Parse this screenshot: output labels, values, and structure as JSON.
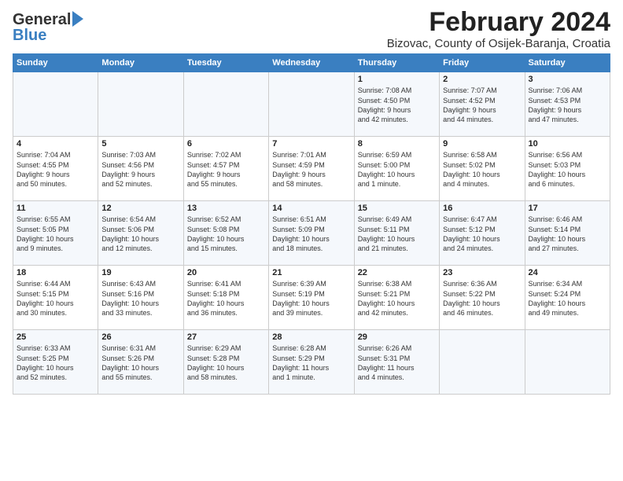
{
  "header": {
    "logo_general": "General",
    "logo_blue": "Blue",
    "main_title": "February 2024",
    "sub_title": "Bizovac, County of Osijek-Baranja, Croatia"
  },
  "calendar": {
    "days_of_week": [
      "Sunday",
      "Monday",
      "Tuesday",
      "Wednesday",
      "Thursday",
      "Friday",
      "Saturday"
    ],
    "weeks": [
      [
        {
          "day": "",
          "info": ""
        },
        {
          "day": "",
          "info": ""
        },
        {
          "day": "",
          "info": ""
        },
        {
          "day": "",
          "info": ""
        },
        {
          "day": "1",
          "info": "Sunrise: 7:08 AM\nSunset: 4:50 PM\nDaylight: 9 hours\nand 42 minutes."
        },
        {
          "day": "2",
          "info": "Sunrise: 7:07 AM\nSunset: 4:52 PM\nDaylight: 9 hours\nand 44 minutes."
        },
        {
          "day": "3",
          "info": "Sunrise: 7:06 AM\nSunset: 4:53 PM\nDaylight: 9 hours\nand 47 minutes."
        }
      ],
      [
        {
          "day": "4",
          "info": "Sunrise: 7:04 AM\nSunset: 4:55 PM\nDaylight: 9 hours\nand 50 minutes."
        },
        {
          "day": "5",
          "info": "Sunrise: 7:03 AM\nSunset: 4:56 PM\nDaylight: 9 hours\nand 52 minutes."
        },
        {
          "day": "6",
          "info": "Sunrise: 7:02 AM\nSunset: 4:57 PM\nDaylight: 9 hours\nand 55 minutes."
        },
        {
          "day": "7",
          "info": "Sunrise: 7:01 AM\nSunset: 4:59 PM\nDaylight: 9 hours\nand 58 minutes."
        },
        {
          "day": "8",
          "info": "Sunrise: 6:59 AM\nSunset: 5:00 PM\nDaylight: 10 hours\nand 1 minute."
        },
        {
          "day": "9",
          "info": "Sunrise: 6:58 AM\nSunset: 5:02 PM\nDaylight: 10 hours\nand 4 minutes."
        },
        {
          "day": "10",
          "info": "Sunrise: 6:56 AM\nSunset: 5:03 PM\nDaylight: 10 hours\nand 6 minutes."
        }
      ],
      [
        {
          "day": "11",
          "info": "Sunrise: 6:55 AM\nSunset: 5:05 PM\nDaylight: 10 hours\nand 9 minutes."
        },
        {
          "day": "12",
          "info": "Sunrise: 6:54 AM\nSunset: 5:06 PM\nDaylight: 10 hours\nand 12 minutes."
        },
        {
          "day": "13",
          "info": "Sunrise: 6:52 AM\nSunset: 5:08 PM\nDaylight: 10 hours\nand 15 minutes."
        },
        {
          "day": "14",
          "info": "Sunrise: 6:51 AM\nSunset: 5:09 PM\nDaylight: 10 hours\nand 18 minutes."
        },
        {
          "day": "15",
          "info": "Sunrise: 6:49 AM\nSunset: 5:11 PM\nDaylight: 10 hours\nand 21 minutes."
        },
        {
          "day": "16",
          "info": "Sunrise: 6:47 AM\nSunset: 5:12 PM\nDaylight: 10 hours\nand 24 minutes."
        },
        {
          "day": "17",
          "info": "Sunrise: 6:46 AM\nSunset: 5:14 PM\nDaylight: 10 hours\nand 27 minutes."
        }
      ],
      [
        {
          "day": "18",
          "info": "Sunrise: 6:44 AM\nSunset: 5:15 PM\nDaylight: 10 hours\nand 30 minutes."
        },
        {
          "day": "19",
          "info": "Sunrise: 6:43 AM\nSunset: 5:16 PM\nDaylight: 10 hours\nand 33 minutes."
        },
        {
          "day": "20",
          "info": "Sunrise: 6:41 AM\nSunset: 5:18 PM\nDaylight: 10 hours\nand 36 minutes."
        },
        {
          "day": "21",
          "info": "Sunrise: 6:39 AM\nSunset: 5:19 PM\nDaylight: 10 hours\nand 39 minutes."
        },
        {
          "day": "22",
          "info": "Sunrise: 6:38 AM\nSunset: 5:21 PM\nDaylight: 10 hours\nand 42 minutes."
        },
        {
          "day": "23",
          "info": "Sunrise: 6:36 AM\nSunset: 5:22 PM\nDaylight: 10 hours\nand 46 minutes."
        },
        {
          "day": "24",
          "info": "Sunrise: 6:34 AM\nSunset: 5:24 PM\nDaylight: 10 hours\nand 49 minutes."
        }
      ],
      [
        {
          "day": "25",
          "info": "Sunrise: 6:33 AM\nSunset: 5:25 PM\nDaylight: 10 hours\nand 52 minutes."
        },
        {
          "day": "26",
          "info": "Sunrise: 6:31 AM\nSunset: 5:26 PM\nDaylight: 10 hours\nand 55 minutes."
        },
        {
          "day": "27",
          "info": "Sunrise: 6:29 AM\nSunset: 5:28 PM\nDaylight: 10 hours\nand 58 minutes."
        },
        {
          "day": "28",
          "info": "Sunrise: 6:28 AM\nSunset: 5:29 PM\nDaylight: 11 hours\nand 1 minute."
        },
        {
          "day": "29",
          "info": "Sunrise: 6:26 AM\nSunset: 5:31 PM\nDaylight: 11 hours\nand 4 minutes."
        },
        {
          "day": "",
          "info": ""
        },
        {
          "day": "",
          "info": ""
        }
      ]
    ]
  }
}
